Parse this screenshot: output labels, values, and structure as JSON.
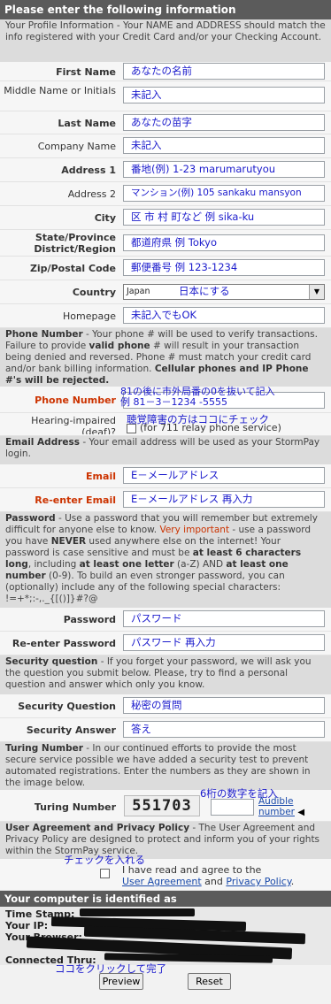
{
  "title": "Please enter the following information",
  "profile_intro": "Your Profile Information - Your NAME and ADDRESS should match the info registered with your Credit Card and/or your Checking Account.",
  "profile_fields": [
    {
      "label": "First Name",
      "value": "あなたの名前"
    },
    {
      "label": "Middle Name or Initials",
      "value": "未記入"
    },
    {
      "label": "Last Name",
      "value": "あなたの苗字"
    },
    {
      "label": "Company Name",
      "value": "未記入"
    },
    {
      "label": "Address 1",
      "value": "番地(例) 1-23 marumarutyou"
    },
    {
      "label": "Address 2",
      "value": "マンション(例) 105 sankaku mansyon"
    },
    {
      "label": "City",
      "value": "区 市 村 町など 例 sika-ku"
    },
    {
      "label": "State/Province District/Region",
      "value": "都道府県 例 Tokyo"
    },
    {
      "label": "Zip/Postal Code",
      "value": "郵便番号 例 123-1234"
    }
  ],
  "country": {
    "label": "Country",
    "selected": "Japan",
    "note": "日本にする"
  },
  "homepage": {
    "label": "Homepage",
    "value": "未記入でもOK"
  },
  "phone_intro": {
    "heading": "Phone Number",
    "text1": " - Your phone # will be used to verify transactions. Failure to provide ",
    "bold": "valid phone",
    "text2": " # will result in your transaction being denied and reversed. Phone # must match your credit card and/or bank billing information. ",
    "bold2": "Cellular phones and IP Phone #'s will be rejected."
  },
  "phone": {
    "label": "Phone Number",
    "note1": "81の後に市外局番の0を抜いて記入",
    "note2": "例 81－3－1234 -5555"
  },
  "hearing": {
    "label": "Hearing-impaired (deaf)?",
    "text": "(for 711 relay phone service)",
    "note": "聴覚障害の方はココにチェック"
  },
  "email_intro": {
    "heading": "Email Address",
    "text": " - Your email address will be used as your StormPay login."
  },
  "email": {
    "label": "Email",
    "value": "E－メールアドレス"
  },
  "email2": {
    "label": "Re-enter Email",
    "value": "E－メールアドレス 再入力"
  },
  "password_intro": {
    "heading": "Password",
    "t1": " - Use a password that you will remember but extremely difficult for anyone else to know. ",
    "vi": "Very important",
    "t2": " - use a password you have ",
    "never": "NEVER",
    "t3": " used anywhere else on the internet! Your password is case sensitive and must be ",
    "b1": "at least 6 characters long",
    "t4": ", including ",
    "b2": "at least one letter",
    "t5": " (a-Z) AND ",
    "b3": "at least one number",
    "t6": " (0-9). To build an even stronger password, you can (optionally) include any of the following special characters: !=+*;:-,._{[()]}#?@"
  },
  "password": {
    "label": "Password",
    "value": "パスワード"
  },
  "password2": {
    "label": "Re-enter Password",
    "value": "パスワード 再入力"
  },
  "security_intro": {
    "heading": "Security question",
    "text": " - If you forget your password, we will ask you the question you submit below. Please, try to find a personal question and answer which only you know."
  },
  "security_question": {
    "label": "Security Question",
    "value": "秘密の質問"
  },
  "security_answer": {
    "label": "Security Answer",
    "value": "答え"
  },
  "turing_intro": {
    "heading": "Turing Number",
    "text": " - In our continued efforts to provide the most secure service possible we have added a security test to prevent automated registrations. Enter the numbers as they are shown in the image below."
  },
  "turing": {
    "label": "Turing Number",
    "captcha": "551703",
    "note": "6桁の数字を記入",
    "audible1": "Audible",
    "audible2": "number"
  },
  "agreement_intro": {
    "heading": "User Agreement and Privacy Policy",
    "text": " - The User Agreement and Privacy Policy are designed to protect and inform you of your rights within the StormPay service."
  },
  "agreement": {
    "note": "チェックを入れる",
    "t1": "I have read and agree to the",
    "link1": "User Agreement",
    "and": " and ",
    "link2": "Privacy Policy",
    "end": "."
  },
  "identified": {
    "title": "Your computer is identified as",
    "lines": [
      "Time Stamp:",
      "Your IP:",
      "Your Browser:",
      "Connected Thru:"
    ]
  },
  "click_note": "ココをクリックして完了",
  "buttons": {
    "preview": "Preview",
    "reset": "Reset"
  },
  "colors": {
    "header": "#5b5b5b",
    "info": "#dcdcdc",
    "row": "#f6f6f6",
    "required_red": "#cc3300",
    "note_blue": "#1a1acc"
  }
}
